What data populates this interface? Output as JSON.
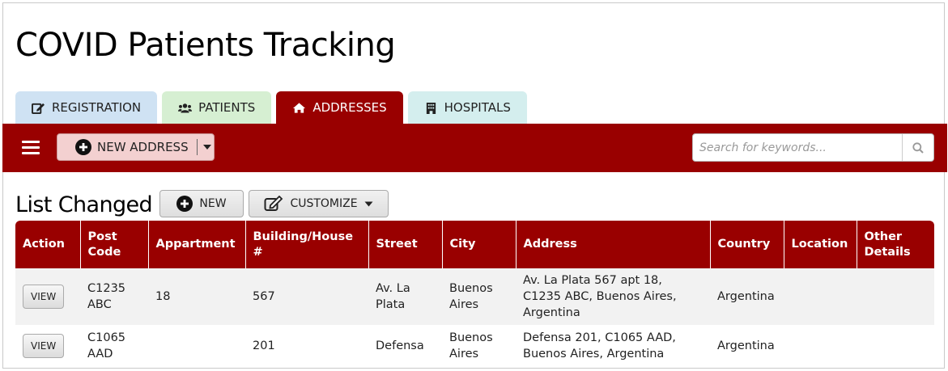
{
  "app": {
    "title": "COVID Patients Tracking"
  },
  "tabs": [
    {
      "label": "REGISTRATION",
      "icon": "edit-icon",
      "color": "#cfe2f3"
    },
    {
      "label": "PATIENTS",
      "icon": "users-icon",
      "color": "#d6efd2"
    },
    {
      "label": "ADDRESSES",
      "icon": "home-icon",
      "color": "#990000",
      "active": true
    },
    {
      "label": "HOSPITALS",
      "icon": "building-icon",
      "color": "#d4eeee"
    }
  ],
  "toolbar": {
    "new_address_label": "NEW ADDRESS",
    "search_placeholder": "Search for keywords...",
    "background": "#990000"
  },
  "list": {
    "title": "List Changed",
    "new_label": "NEW",
    "customize_label": "CUSTOMIZE"
  },
  "table": {
    "columns": [
      "Action",
      "Post Code",
      "Appartment",
      "Building/House #",
      "Street",
      "City",
      "Address",
      "Country",
      "Location",
      "Other Details"
    ],
    "rows": [
      {
        "action": "VIEW",
        "post_code": "C1235 ABC",
        "appartment": "18",
        "building": "567",
        "street": "Av. La Plata",
        "city": "Buenos Aires",
        "address": "Av. La Plata 567 apt 18, C1235 ABC, Buenos Aires, Argentina",
        "country": "Argentina",
        "location": "",
        "other": ""
      },
      {
        "action": "VIEW",
        "post_code": "C1065 AAD",
        "appartment": "",
        "building": "201",
        "street": "Defensa",
        "city": "Buenos Aires",
        "address": "Defensa 201, C1065 AAD, Buenos Aires, Argentina",
        "country": "Argentina",
        "location": "",
        "other": ""
      }
    ]
  }
}
